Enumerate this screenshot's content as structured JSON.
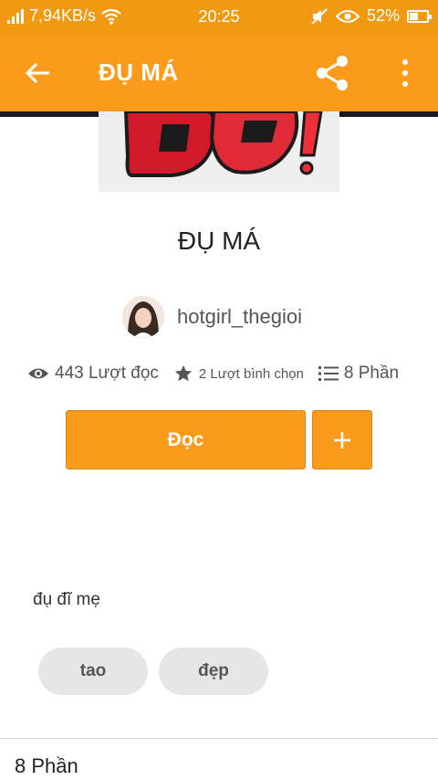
{
  "status_bar": {
    "network_speed": "7,94KB/s",
    "time": "20:25",
    "battery_percent": "52%",
    "battery_level": 0.52
  },
  "toolbar": {
    "title": "ĐỤ MÁ"
  },
  "story": {
    "title": "ĐỤ MÁ",
    "author": "hotgirl_thegioi",
    "reads": "443 Lượt đọc",
    "votes": "2 Lượt bình chọn",
    "parts": "8 Phần",
    "description": "đụ đĩ mẹ"
  },
  "actions": {
    "read_label": "Đọc",
    "add_label": "+"
  },
  "tags": [
    "tao",
    "đẹp"
  ],
  "footer": {
    "parts_label": "8 Phần"
  },
  "colors": {
    "accent": "#fb9b1c",
    "status_bar": "#f19a11"
  }
}
